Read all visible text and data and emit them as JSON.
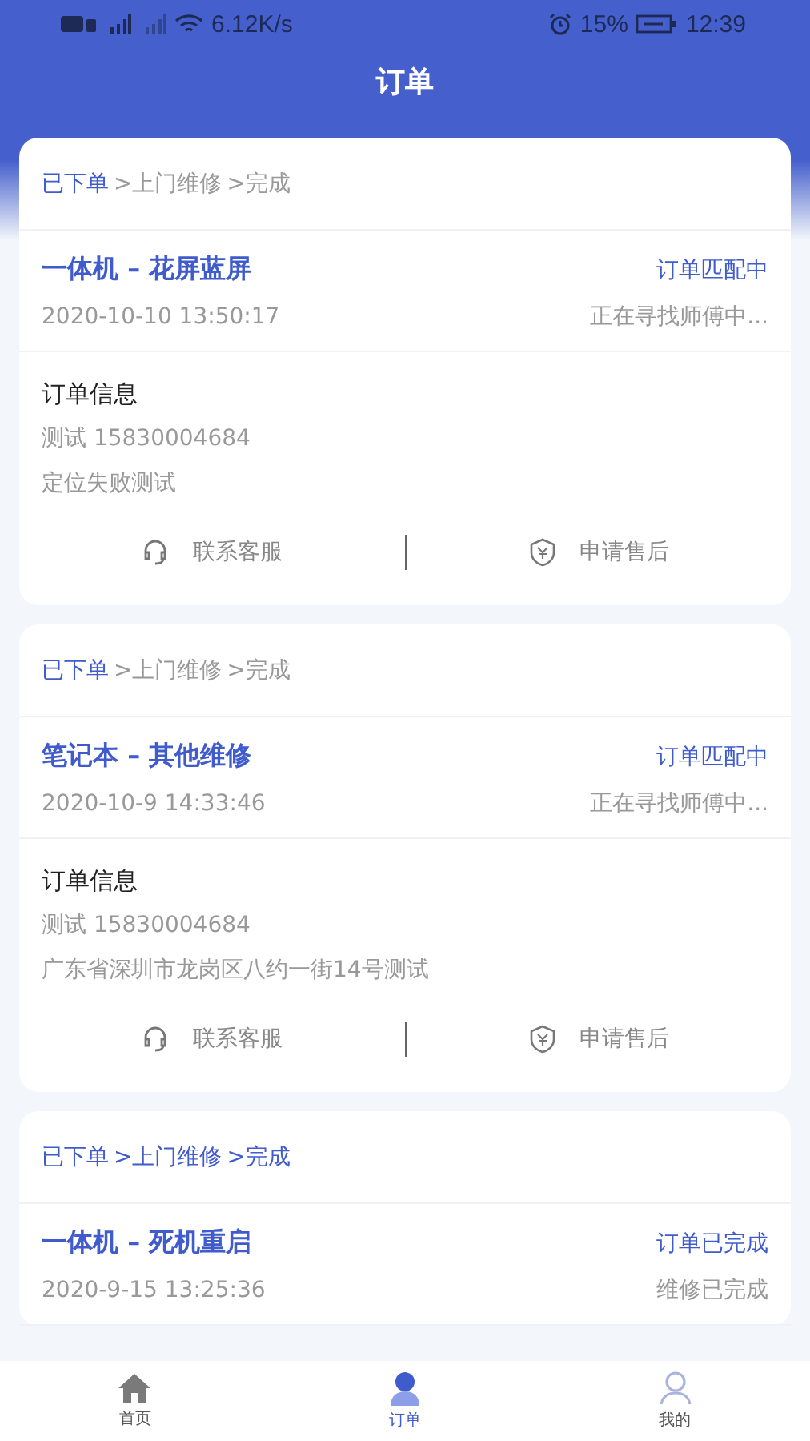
{
  "status_bar": {
    "speed": "6.12K/s",
    "battery": "15%",
    "time": "12:39"
  },
  "header": {
    "title": "订单"
  },
  "orders": [
    {
      "steps": [
        {
          "label": "已下单",
          "done": true
        },
        {
          "label": ">上门维修",
          "done": false
        },
        {
          "label": ">完成",
          "done": false
        }
      ],
      "title": "一体机 – 花屏蓝屏",
      "status": "订单匹配中",
      "date": "2020-10-10 13:50:17",
      "note": "正在寻找师傅中...",
      "info": {
        "heading": "订单信息",
        "lines": [
          "测试  15830004684",
          "定位失败测试"
        ]
      },
      "actions": [
        {
          "kind": "service",
          "label": "联系客服"
        },
        {
          "kind": "after_sale",
          "label": "申请售后"
        }
      ]
    },
    {
      "steps": [
        {
          "label": "已下单",
          "done": true
        },
        {
          "label": ">上门维修",
          "done": false
        },
        {
          "label": ">完成",
          "done": false
        }
      ],
      "title": "笔记本 – 其他维修",
      "status": "订单匹配中",
      "date": "2020-10-9 14:33:46",
      "note": "正在寻找师傅中...",
      "info": {
        "heading": "订单信息",
        "lines": [
          "测试  15830004684",
          "广东省深圳市龙岗区八约一街14号测试"
        ]
      },
      "actions": [
        {
          "kind": "service",
          "label": "联系客服"
        },
        {
          "kind": "after_sale",
          "label": "申请售后"
        }
      ]
    },
    {
      "steps": [
        {
          "label": "已下单",
          "done": true
        },
        {
          "label": ">上门维修",
          "done": true
        },
        {
          "label": ">完成",
          "done": true
        }
      ],
      "title": "一体机 – 死机重启",
      "status": "订单已完成",
      "date": "2020-9-15 13:25:36",
      "note": "维修已完成"
    }
  ],
  "nav": [
    {
      "kind": "home",
      "label": "首页",
      "selected": false
    },
    {
      "kind": "orders",
      "label": "订单",
      "selected": true
    },
    {
      "kind": "me",
      "label": "我的",
      "selected": false
    }
  ]
}
